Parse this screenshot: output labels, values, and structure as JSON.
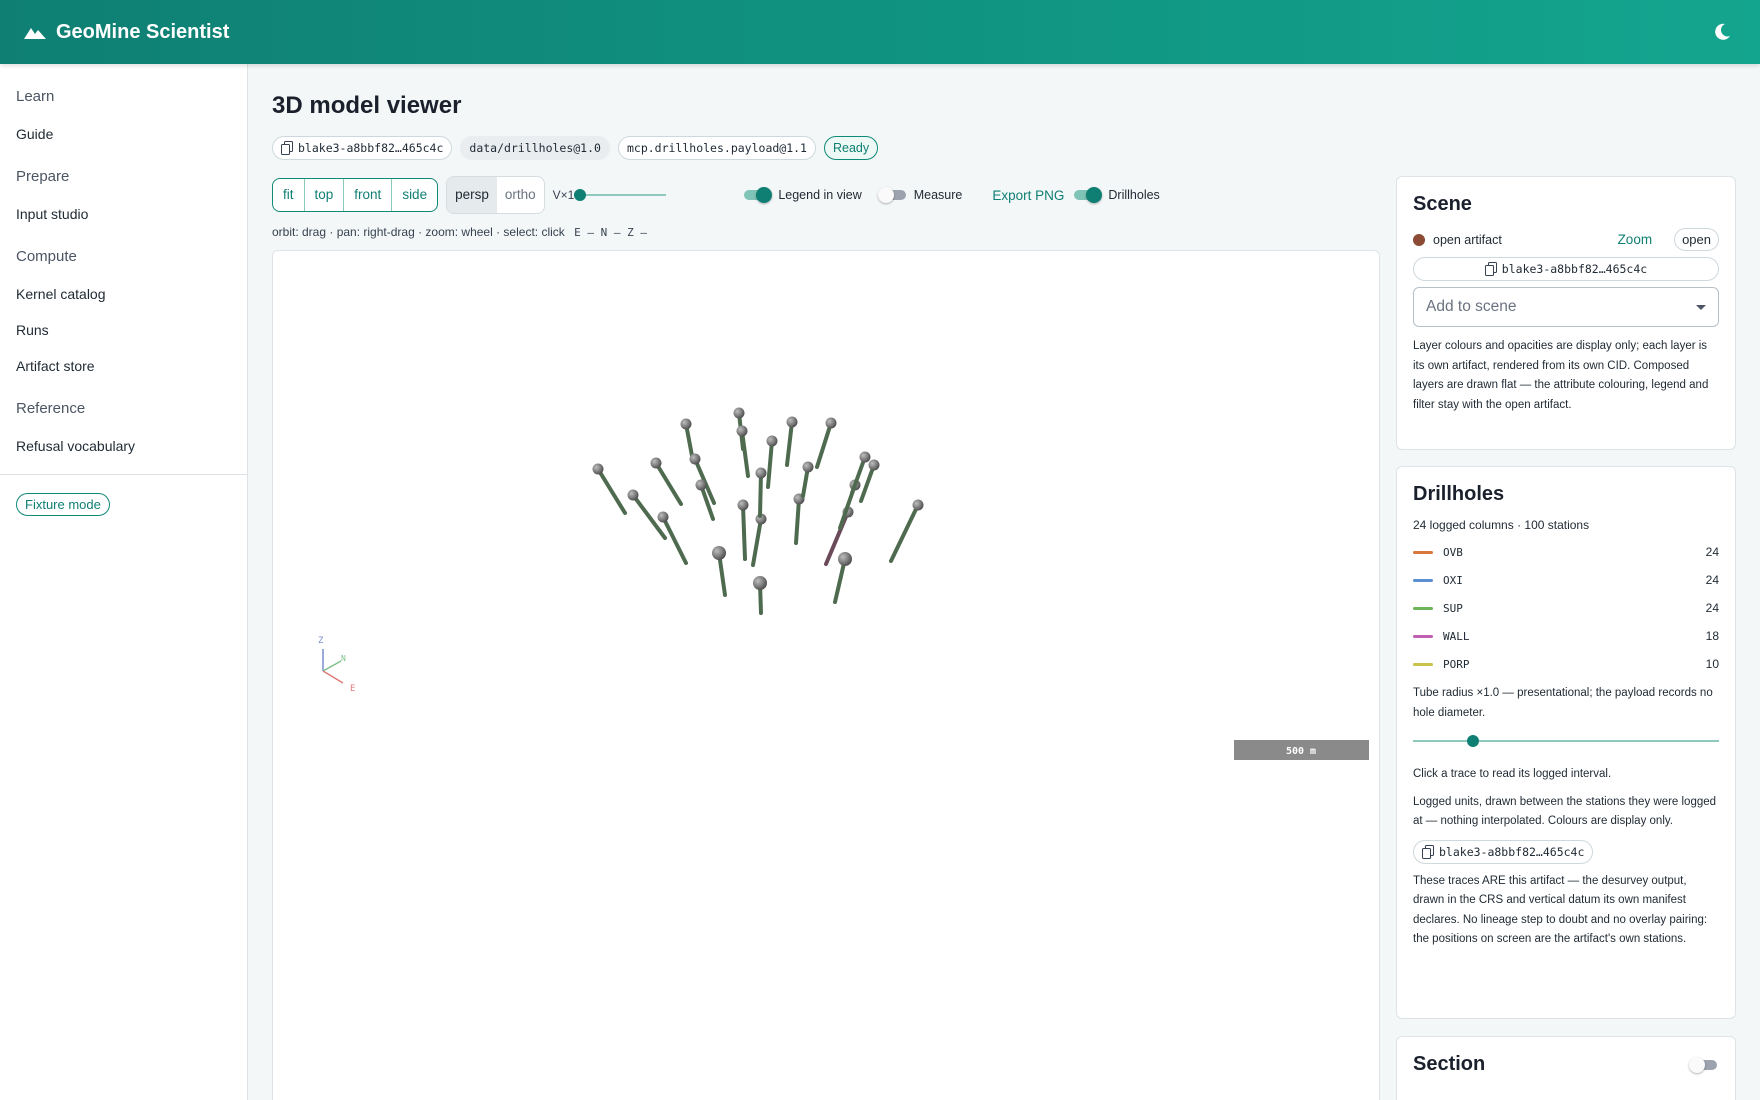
{
  "app": {
    "title": "GeoMine Scientist",
    "logo_icon": "mountain-icon",
    "theme_icon": "moon-icon"
  },
  "colors": {
    "accent": "#0f7f73",
    "header_start": "#0f7f73",
    "header_end": "#14a58f"
  },
  "sidebar": {
    "sections": [
      {
        "heading": "Learn",
        "items": [
          "Guide"
        ]
      },
      {
        "heading": "Prepare",
        "items": [
          "Input studio"
        ]
      },
      {
        "heading": "Compute",
        "items": [
          "Kernel catalog",
          "Runs",
          "Artifact store"
        ]
      },
      {
        "heading": "Reference",
        "items": [
          "Refusal vocabulary"
        ]
      }
    ],
    "fixture_label": "Fixture mode"
  },
  "main": {
    "title": "3D model viewer",
    "chips": {
      "cid": "blake3-a8bbf82…465c4c",
      "dataset": "data/drillholes@1.0",
      "payload": "mcp.drillholes.payload@1.1",
      "status": "Ready"
    },
    "toolbar": {
      "views": [
        "fit",
        "top",
        "front",
        "side"
      ],
      "projections": [
        "persp",
        "ortho"
      ],
      "projection_selected": "persp",
      "vx_label": "V×1",
      "vertical_exaggeration": 1,
      "legend_label": "Legend in view",
      "legend_on": true,
      "measure_label": "Measure",
      "measure_on": false,
      "export_label": "Export PNG",
      "drillholes_label": "Drillholes",
      "drillholes_on": true
    },
    "hint": "orbit: drag · pan: right-drag · zoom: wheel · select: click",
    "hint_axes": "E — N — Z —",
    "viewport": {
      "scale_bar": "500 m",
      "axes": {
        "z": "Z",
        "n": "N",
        "e": "E"
      }
    }
  },
  "scene_panel": {
    "title": "Scene",
    "artifact_label": "open artifact",
    "zoom_label": "Zoom",
    "open_label": "open",
    "cid": "blake3-a8bbf82…465c4c",
    "add_placeholder": "Add to scene",
    "note": "Layer colours and opacities are display only; each layer is its own artifact, rendered from its own CID. Composed layers are drawn flat — the attribute colouring, legend and filter stay with the open artifact."
  },
  "drillholes_panel": {
    "title": "Drillholes",
    "summary": "24 logged columns · 100 stations",
    "legend": [
      {
        "code": "OVB",
        "count": "24",
        "color": "#d9773f"
      },
      {
        "code": "OXI",
        "count": "24",
        "color": "#5b8fd0"
      },
      {
        "code": "SUP",
        "count": "24",
        "color": "#6fb35a"
      },
      {
        "code": "WALL",
        "count": "18",
        "color": "#c15fb0"
      },
      {
        "code": "PORP",
        "count": "10",
        "color": "#c9c24b"
      }
    ],
    "radius_note": "Tube radius ×1.0 — presentational; the payload records no hole diameter.",
    "tube_radius": 1.0,
    "click_note": "Click a trace to read its logged interval.",
    "logged_note": "Logged units, drawn between the stations they were logged at — nothing interpolated. Colours are display only.",
    "cid": "blake3-a8bbf82…465c4c",
    "traces_note": "These traces ARE this artifact — the desurvey output, drawn in the CRS and vertical datum its own manifest declares. No lineage step to doubt and no overlay pairing: the positions on screen are the artifact's own stations."
  },
  "section_panel": {
    "title": "Section",
    "on": false
  }
}
